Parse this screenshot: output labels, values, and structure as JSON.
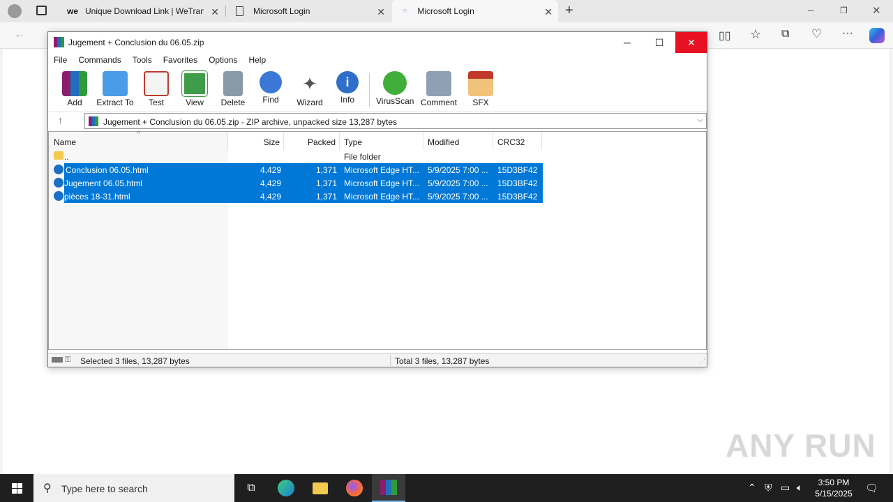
{
  "browser": {
    "tabs": [
      {
        "label": "Unique Download Link | WeTrans",
        "icon": "wetransfer-icon"
      },
      {
        "label": "Microsoft Login",
        "icon": "page-icon"
      },
      {
        "label": "Microsoft Login",
        "icon": "loading-icon"
      }
    ]
  },
  "rar": {
    "title": "Jugement + Conclusion du 06.05.zip",
    "menu": [
      "File",
      "Commands",
      "Tools",
      "Favorites",
      "Options",
      "Help"
    ],
    "toolbar": [
      "Add",
      "Extract To",
      "Test",
      "View",
      "Delete",
      "Find",
      "Wizard",
      "Info",
      "VirusScan",
      "Comment",
      "SFX"
    ],
    "path": "Jugement + Conclusion du 06.05.zip - ZIP archive, unpacked size 13,287 bytes",
    "columns": [
      "Name",
      "Size",
      "Packed",
      "Type",
      "Modified",
      "CRC32"
    ],
    "parent_row": {
      "name": "..",
      "type": "File folder"
    },
    "files": [
      {
        "name": "Conclusion 06.05.html",
        "size": "4,429",
        "packed": "1,371",
        "type": "Microsoft Edge HT...",
        "modified": "5/9/2025 7:00 ...",
        "crc": "15D3BF42"
      },
      {
        "name": "Jugement 06.05.html",
        "size": "4,429",
        "packed": "1,371",
        "type": "Microsoft Edge HT...",
        "modified": "5/9/2025 7:00 ...",
        "crc": "15D3BF42"
      },
      {
        "name": "pièces 18-31.html",
        "size": "4,429",
        "packed": "1,371",
        "type": "Microsoft Edge HT...",
        "modified": "5/9/2025 7:00 ...",
        "crc": "15D3BF42"
      }
    ],
    "status_selected": "Selected 3 files, 13,287 bytes",
    "status_total": "Total 3 files, 13,287 bytes"
  },
  "watermark": "ANY RUN",
  "taskbar": {
    "search_placeholder": "Type here to search",
    "time": "3:50 PM",
    "date": "5/15/2025"
  },
  "colors": {
    "selection": "#0078d7",
    "close": "#e81123",
    "taskbar": "#1f1f1f"
  }
}
